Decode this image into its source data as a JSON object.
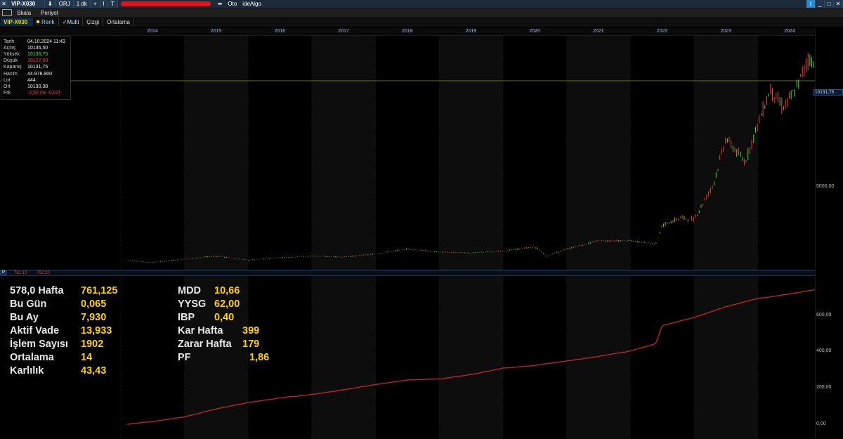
{
  "topbar": {
    "close": "✕",
    "symbol": "VIP-X030",
    "down": "⬇",
    "orj": "ORJ",
    "interval": "1 dk",
    "plus": "+",
    "bar": "I",
    "t": "T",
    "arrow": "➡",
    "oto": "Oto",
    "idealgo": "ideAlgo",
    "right_buttons": [
      "t",
      "_",
      "□",
      "✕"
    ]
  },
  "menubar": {
    "items": [
      "Skala",
      "Periyot"
    ]
  },
  "toolbar": {
    "symbol": "VIP-X030",
    "renk": "Renk",
    "multi": "✓Multi",
    "cizgi": "Çizgi",
    "ortalama": "Ortalama"
  },
  "years": [
    "2014",
    "2015",
    "2016",
    "2017",
    "2018",
    "2019",
    "2020",
    "2021",
    "2022",
    "2023",
    "2024"
  ],
  "info": {
    "rows": [
      {
        "label": "Tarih",
        "value": "04.10.2024 11:43",
        "tone": "normal"
      },
      {
        "label": "Açılış",
        "value": "10136,50",
        "tone": "normal"
      },
      {
        "label": "Yüksek",
        "value": "10136,75",
        "tone": "green"
      },
      {
        "label": "Düşük",
        "value": "10127,50",
        "tone": "red"
      },
      {
        "label": "Kapanış",
        "value": "10131,75",
        "tone": "normal"
      },
      {
        "label": "Hacim",
        "value": "44.978.900",
        "tone": "normal"
      },
      {
        "label": "Lot",
        "value": "444",
        "tone": "normal"
      },
      {
        "label": "Ort",
        "value": "10130,38",
        "tone": "normal"
      },
      {
        "label": "Frk",
        "value": "-2,50 (% -0,02)",
        "tone": "red"
      }
    ]
  },
  "divider": {
    "p": "P",
    "v1": "761,13",
    "v2": "752,20"
  },
  "axis": {
    "price_label": "10131,75",
    "price_tick": "5000,00",
    "equity_ticks": [
      "600,00",
      "400,00",
      "200,00",
      "0,00"
    ]
  },
  "stats": {
    "left": [
      {
        "label": "578,0 Hafta",
        "value": "761,125"
      },
      {
        "label": "Bu Gün",
        "value": "0,065"
      },
      {
        "label": "Bu Ay",
        "value": "7,930"
      },
      {
        "label": "Aktif Vade",
        "value": "13,933"
      },
      {
        "label": "İşlem Sayısı",
        "value": "1902"
      },
      {
        "label": "Ortalama",
        "value": "14"
      },
      {
        "label": "Karlılık",
        "value": "43,43"
      }
    ],
    "right": [
      {
        "label": "MDD",
        "value": "10,66"
      },
      {
        "label": "YYSG",
        "value": "62,00"
      },
      {
        "label": "IBP",
        "value": "0,40"
      },
      {
        "label": "Kar Hafta",
        "value": "399"
      },
      {
        "label": "Zarar Hafta",
        "value": "179"
      },
      {
        "label": "PF",
        "value": "1,86"
      }
    ]
  },
  "colors": {
    "up": "#39e639",
    "down": "#ff3a3a",
    "equity": "#b82828",
    "price_line": "#8a8a1a",
    "stat_value": "#ffd200"
  },
  "chart_data": [
    {
      "type": "line",
      "series": [
        {
          "x": [
            2013.6,
            2014.0,
            2014.5,
            2015.0,
            2015.5,
            2016.0,
            2016.5,
            2017.0,
            2017.5,
            2018.0,
            2018.5,
            2019.0,
            2019.5,
            2020.0,
            2020.2,
            2020.5,
            2021.0,
            2021.5,
            2021.9,
            2022.0,
            2022.3,
            2022.5,
            2022.8,
            2023.0,
            2023.3,
            2023.5,
            2023.7,
            2023.9,
            2024.1,
            2024.3,
            2024.5,
            2024.76
          ],
          "y": [
            1300,
            1180,
            1350,
            1500,
            1300,
            1420,
            1500,
            1450,
            1600,
            1850,
            1700,
            1650,
            1750,
            1950,
            1500,
            1850,
            2250,
            2250,
            2100,
            3000,
            3400,
            3300,
            5000,
            7300,
            6100,
            8000,
            9700,
            8800,
            9700,
            11300,
            10300,
            10131.75
          ]
        }
      ],
      "ylim": [
        1000,
        12000
      ]
    },
    {
      "type": "line",
      "series": [
        {
          "x": [
            2013.6,
            2014.0,
            2014.5,
            2015.0,
            2015.5,
            2016.0,
            2016.5,
            2017.0,
            2017.5,
            2018.0,
            2018.5,
            2019.0,
            2019.5,
            2020.0,
            2020.5,
            2021.0,
            2021.5,
            2021.9,
            2022.0,
            2022.5,
            2023.0,
            2023.5,
            2024.0,
            2024.5,
            2024.76
          ],
          "y": [
            0,
            15,
            40,
            85,
            120,
            145,
            165,
            190,
            220,
            245,
            250,
            275,
            310,
            325,
            350,
            375,
            405,
            445,
            545,
            590,
            650,
            695,
            720,
            750,
            761.13
          ]
        }
      ],
      "ylim": [
        0,
        800
      ]
    }
  ]
}
